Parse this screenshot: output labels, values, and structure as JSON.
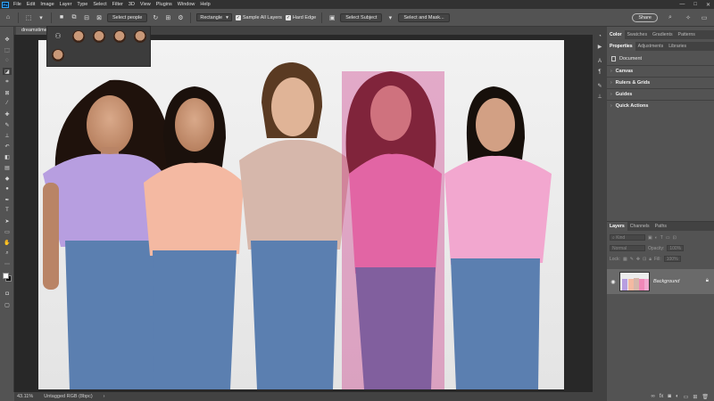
{
  "menu": {
    "app_icon": "Ps",
    "items": [
      "File",
      "Edit",
      "Image",
      "Layer",
      "Type",
      "Select",
      "Filter",
      "3D",
      "View",
      "Plugins",
      "Window",
      "Help"
    ],
    "window_controls": [
      "—",
      "□",
      "✕"
    ]
  },
  "options_bar": {
    "select_people_label": "Select people",
    "mode_value": "Rectangle",
    "sample_all_layers_label": "Sample All Layers",
    "hard_edge_label": "Hard Edge",
    "select_subject_label": "Select Subject",
    "select_and_mask_label": "Select and Mask...",
    "share_label": "Share"
  },
  "document": {
    "tab_title": "dreamstime"
  },
  "status": {
    "zoom": "43.11%",
    "profile": "Untagged RGB (8bpc)"
  },
  "panels": {
    "top_tabs": [
      "Color",
      "Swatches",
      "Gradients",
      "Patterns"
    ],
    "second_tabs": [
      "Properties",
      "Adjustments",
      "Libraries"
    ],
    "properties_type": "Document",
    "sections": [
      "Canvas",
      "Rulers & Grids",
      "Guides",
      "Quick Actions"
    ]
  },
  "layers": {
    "tabs": [
      "Layers",
      "Channels",
      "Paths"
    ],
    "filter_placeholder": "Kind",
    "blend_mode": "Normal",
    "opacity_label": "Opacity:",
    "opacity_value": "100%",
    "lock_label": "Lock:",
    "fill_label": "Fill:",
    "fill_value": "100%",
    "layer_name": "Background"
  },
  "colors": {
    "shirts": [
      "#b79ee0",
      "#f4b9a2",
      "#d6b7ab",
      "#f088b8",
      "#f2a7cf"
    ],
    "jeans": "#5b7fb0",
    "selection_overlay": "#c8267e"
  }
}
